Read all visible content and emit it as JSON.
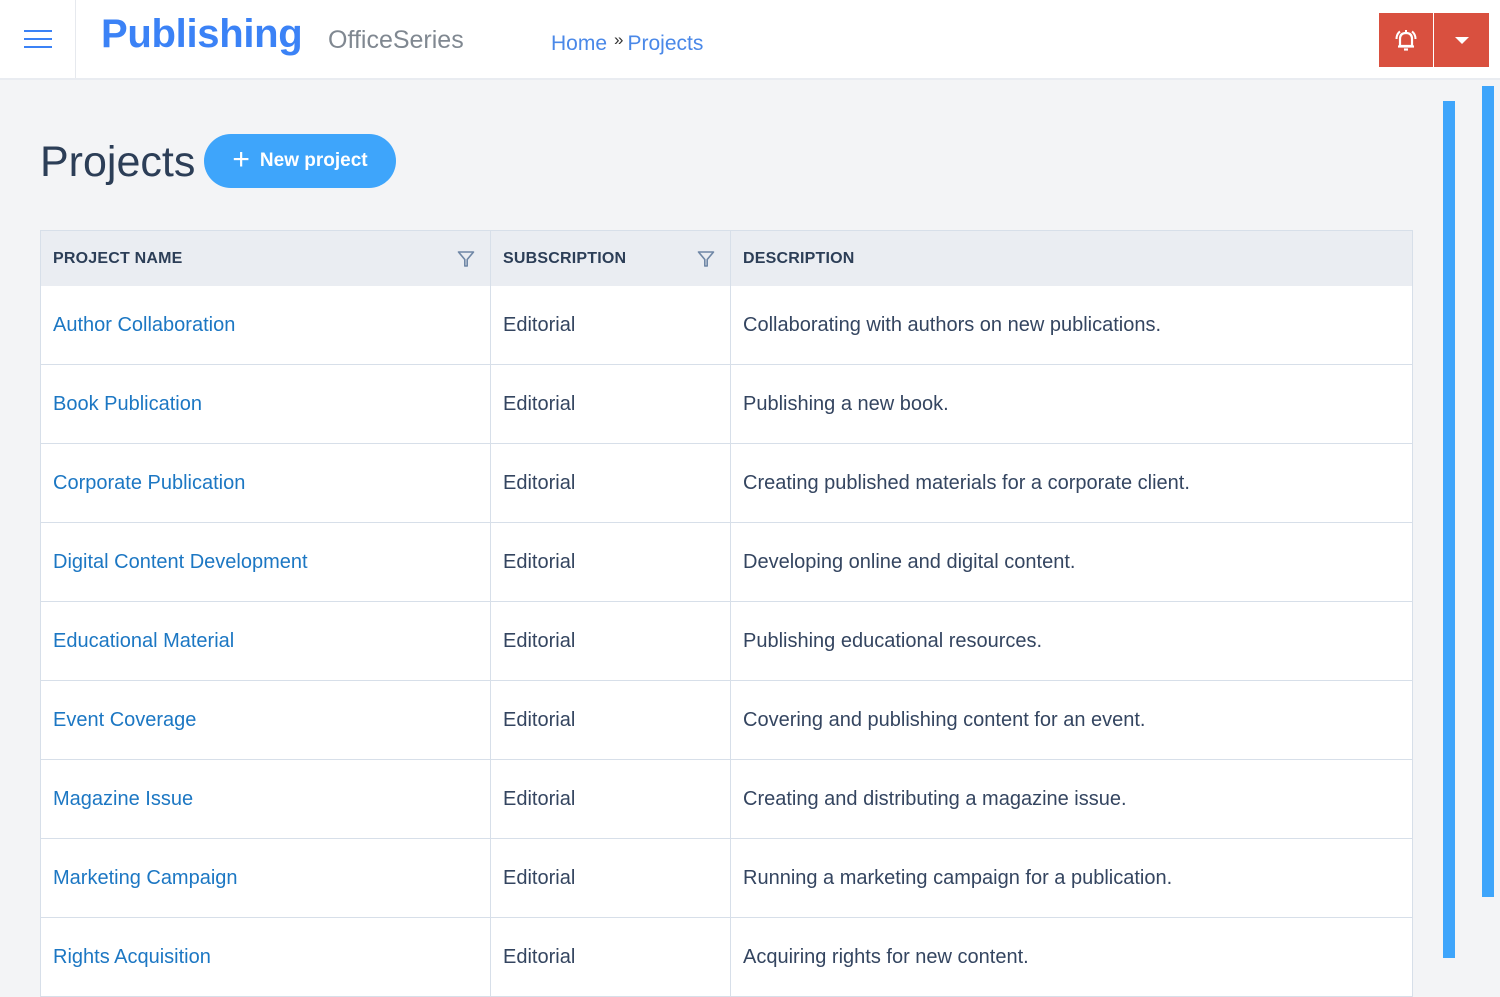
{
  "header": {
    "brand": "Publishing",
    "suite": "OfficeSeries",
    "breadcrumb": [
      {
        "label": "Home"
      },
      {
        "label": "Projects"
      }
    ],
    "breadcrumb_separator": "»",
    "icons": {
      "menu": "hamburger-menu-icon",
      "alert": "bell-alert-icon",
      "dropdown": "caret-down-icon"
    },
    "accent_color": "#3b82f6",
    "alert_color": "#d9503f"
  },
  "page": {
    "title": "Projects",
    "new_button": {
      "label": "New project",
      "icon": "plus-icon",
      "color": "#3ea5fb"
    }
  },
  "table": {
    "columns": [
      {
        "label": "PROJECT NAME",
        "filterable": true
      },
      {
        "label": "SUBSCRIPTION",
        "filterable": true
      },
      {
        "label": "DESCRIPTION",
        "filterable": false
      }
    ],
    "rows": [
      {
        "name": "Author Collaboration",
        "subscription": "Editorial",
        "description": "Collaborating with authors on new publications."
      },
      {
        "name": "Book Publication",
        "subscription": "Editorial",
        "description": "Publishing a new book."
      },
      {
        "name": "Corporate Publication",
        "subscription": "Editorial",
        "description": "Creating published materials for a corporate client."
      },
      {
        "name": "Digital Content Development",
        "subscription": "Editorial",
        "description": "Developing online and digital content."
      },
      {
        "name": "Educational Material",
        "subscription": "Editorial",
        "description": "Publishing educational resources."
      },
      {
        "name": "Event Coverage",
        "subscription": "Editorial",
        "description": "Covering and publishing content for an event."
      },
      {
        "name": "Magazine Issue",
        "subscription": "Editorial",
        "description": "Creating and distributing a magazine issue."
      },
      {
        "name": "Marketing Campaign",
        "subscription": "Editorial",
        "description": "Running a marketing campaign for a publication."
      },
      {
        "name": "Rights Acquisition",
        "subscription": "Editorial",
        "description": "Acquiring rights for new content."
      }
    ]
  }
}
